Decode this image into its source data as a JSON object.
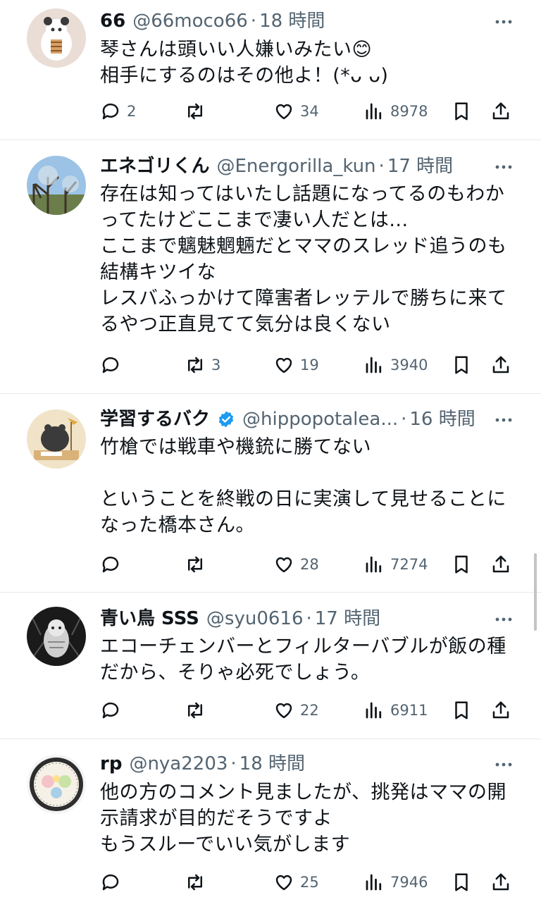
{
  "tweets": [
    {
      "name": "66",
      "handle": "@66moco66",
      "sep": "·",
      "time": "18 時間",
      "verified": false,
      "body": "琴さんは頭いい人嫌いみたい😊\n相手にするのはその他よ！(*ᴗ ᴗ)",
      "replies": "2",
      "reposts": "",
      "likes": "34",
      "views": "8978"
    },
    {
      "name": "エネゴリくん",
      "handle": "@Energorilla_kun",
      "sep": "·",
      "time": "17 時間",
      "verified": false,
      "body": "存在は知ってはいたし話題になってるのもわか\nってたけどここまで凄い人だとは...\nここまで魑魅魍魎だとママのスレッド追うのも\n結構キツイな\nレスバふっかけて障害者レッテルで勝ちに来て\nるやつ正直見てて気分は良くない",
      "replies": "",
      "reposts": "3",
      "likes": "19",
      "views": "3940"
    },
    {
      "name": "学習するバク",
      "handle": "@hippopotalea...",
      "sep": "·",
      "time": "16 時間",
      "verified": true,
      "body": "竹槍では戦車や機銃に勝てない\n\nということを終戦の日に実演して見せることに\nなった橋本さん。",
      "replies": "",
      "reposts": "",
      "likes": "28",
      "views": "7274"
    },
    {
      "name": "青い鳥 SSS",
      "handle": "@syu0616",
      "sep": "·",
      "time": "17 時間",
      "verified": false,
      "body": "エコーチェンバーとフィルターバブルが飯の種\nだから、そりゃ必死でしょう。",
      "replies": "",
      "reposts": "",
      "likes": "22",
      "views": "6911"
    },
    {
      "name": "rp",
      "handle": "@nya2203",
      "sep": "·",
      "time": "18 時間",
      "verified": false,
      "body": "他の方のコメント見ましたが、挑発はママの開\n示請求が目的だそうですよ\nもうスルーでいい気がします",
      "replies": "",
      "reposts": "",
      "likes": "25",
      "views": "7946"
    }
  ],
  "colors": {
    "text": "#0f1419",
    "secondary": "#536471",
    "divider": "#e6e8eb",
    "verified": "#1d9bf0"
  },
  "icons": [
    "reply-icon",
    "repost-icon",
    "like-icon",
    "views-icon",
    "bookmark-icon",
    "share-icon",
    "more-icon",
    "verified-icon"
  ]
}
